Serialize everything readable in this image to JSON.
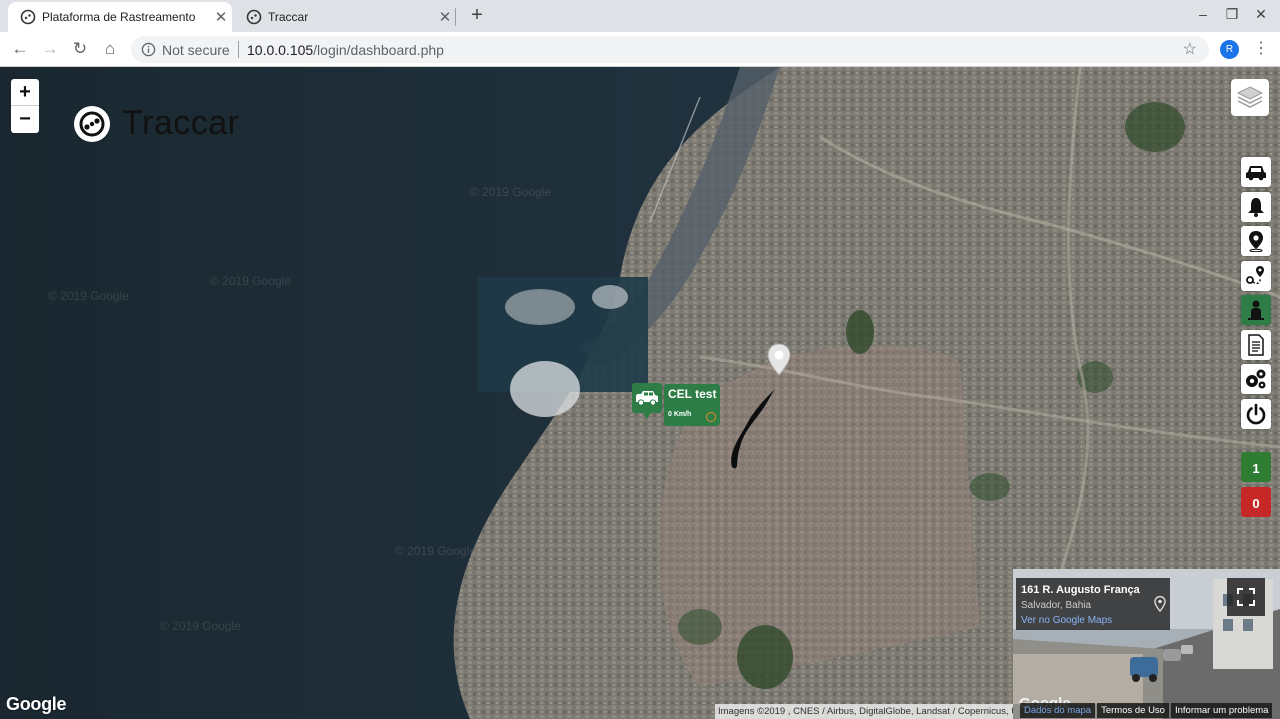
{
  "browser": {
    "tabs": [
      {
        "title": "Plataforma de Rastreamento",
        "active": true
      },
      {
        "title": "Traccar",
        "active": false
      }
    ],
    "security_label": "Not secure",
    "url_host": "10.0.0.105",
    "url_path": "/login/dashboard.php",
    "profile_initial": "R"
  },
  "map": {
    "zoom_in": "+",
    "zoom_out": "−",
    "brand": "Traccar",
    "watermark": "© 2019 Google",
    "side_buttons": [
      "car-icon",
      "bell-icon",
      "location-pin-icon",
      "route-icon",
      "person-icon",
      "document-icon",
      "gears-icon",
      "power-icon"
    ],
    "online_count": "1",
    "offline_count": "0",
    "colors": {
      "online": "#2e7d32",
      "offline": "#c62828",
      "marker": "#2e7d46"
    },
    "vehicle": {
      "name": "CEL test",
      "speed": "0 Km/h"
    },
    "google_logo": "Google",
    "attribution": "Imagens ©2019 , CNES / Airbus, DigitalGlobe, Landsat / Copernicus, U"
  },
  "street_view": {
    "address": "161 R. Augusto França",
    "city": "Salvador, Bahia",
    "link": "Ver no Google Maps",
    "google": "Google",
    "footer_links": [
      "Dados do mapa",
      "Termos de Uso",
      "Informar um problema"
    ]
  }
}
